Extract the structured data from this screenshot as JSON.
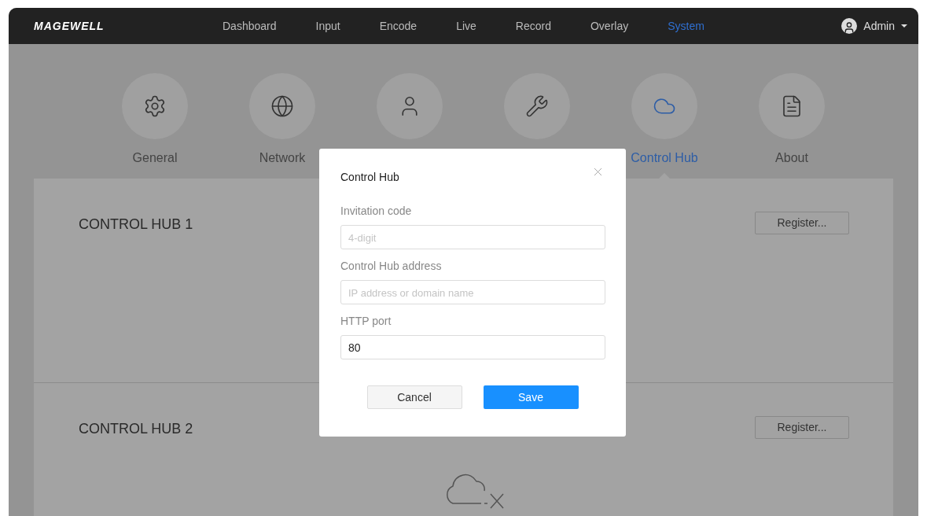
{
  "header": {
    "logo": "MAGEWELL",
    "nav": [
      {
        "label": "Dashboard",
        "selected": false
      },
      {
        "label": "Input",
        "selected": false
      },
      {
        "label": "Encode",
        "selected": false
      },
      {
        "label": "Live",
        "selected": false
      },
      {
        "label": "Record",
        "selected": false
      },
      {
        "label": "Overlay",
        "selected": false
      },
      {
        "label": "System",
        "selected": true
      }
    ],
    "user": "Admin"
  },
  "system_tabs": [
    {
      "label": "General",
      "selected": false
    },
    {
      "label": "Network",
      "selected": false
    },
    {
      "selected": false
    },
    {
      "selected": false
    },
    {
      "label": "Control Hub",
      "selected": true
    },
    {
      "label": "About",
      "selected": false
    }
  ],
  "hubs": [
    {
      "title": "CONTROL HUB 1",
      "button": "Register..."
    },
    {
      "title": "CONTROL HUB 2",
      "button": "Register..."
    }
  ],
  "dialog": {
    "title": "Control Hub",
    "fields": [
      {
        "label": "Invitation code",
        "placeholder": "4-digit"
      },
      {
        "label": "Control Hub address",
        "placeholder": "IP address or domain name"
      },
      {
        "label": "HTTP port",
        "value": "80"
      }
    ],
    "cancel": "Cancel",
    "save": "Save"
  }
}
